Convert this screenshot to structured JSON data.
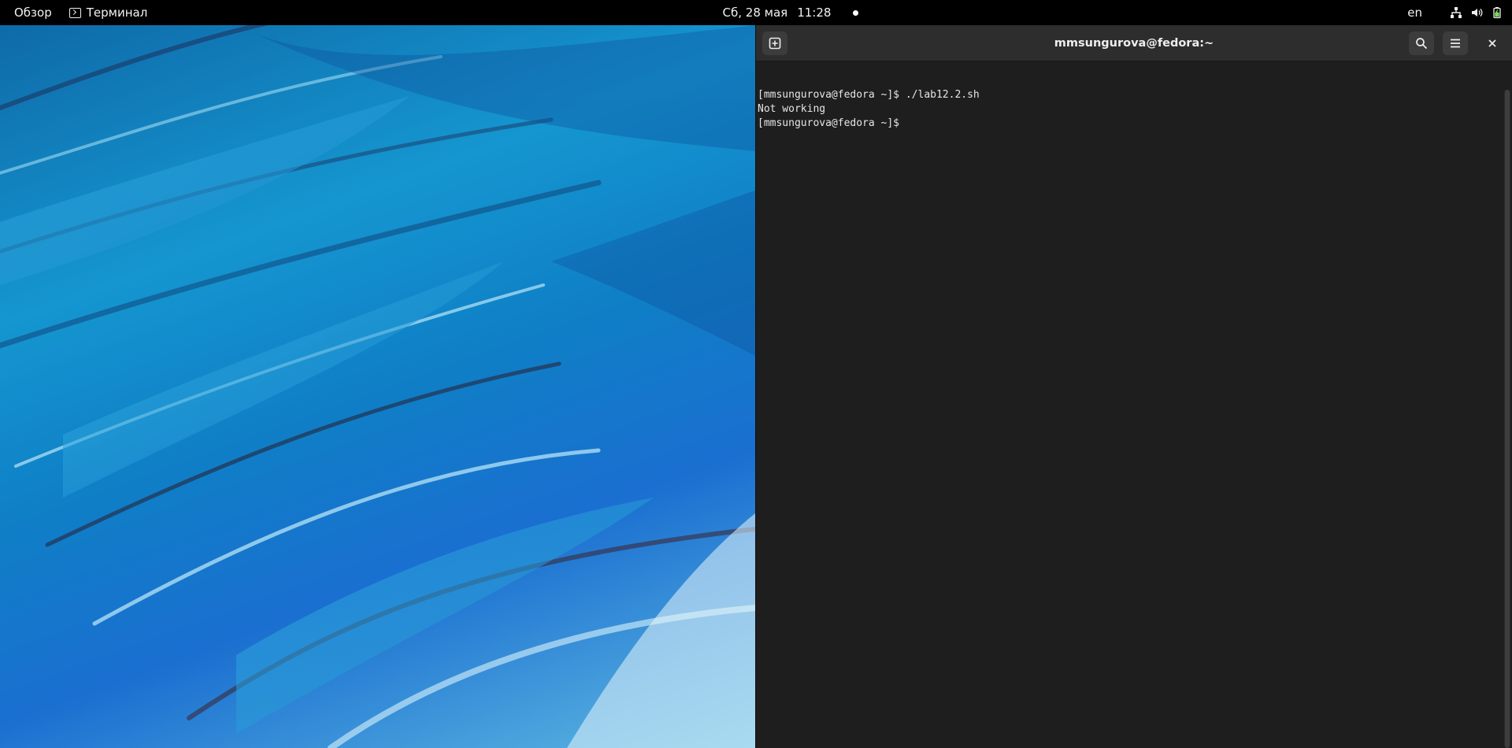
{
  "topbar": {
    "activities": "Обзор",
    "app_menu": "Терминал",
    "clock": {
      "date": "Сб, 28 мая",
      "time": "11:28"
    },
    "lang": "en",
    "tray_icons": [
      "network-wired-icon",
      "volume-icon",
      "battery-charging-icon"
    ]
  },
  "terminal": {
    "title": "mmsungurova@fedora:~",
    "lines": [
      "[mmsungurova@fedora ~]$ ./lab12.2.sh",
      "Not working",
      "[mmsungurova@fedora ~]$ "
    ]
  },
  "colors": {
    "topbar_bg": "#000000",
    "terminal_bg": "#1e1e1e",
    "headerbar_bg": "#2d2d2d",
    "battery_green": "#7ed957"
  }
}
